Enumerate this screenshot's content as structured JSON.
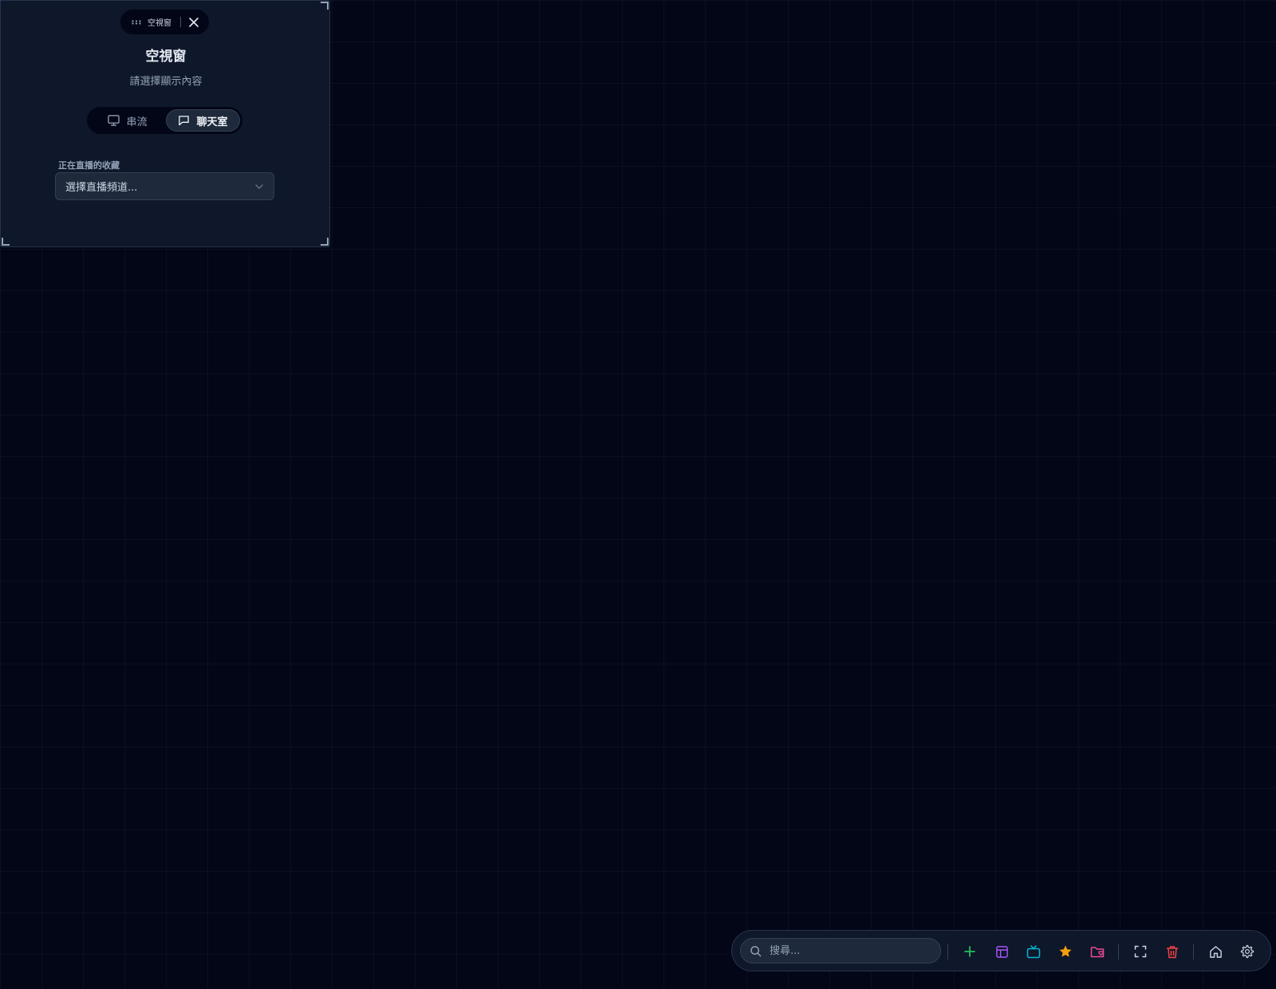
{
  "panel": {
    "header_label": "空視窗",
    "title": "空視窗",
    "subtitle": "請選擇顯示內容",
    "tabs": [
      {
        "label": "串流",
        "icon": "monitor-icon",
        "active": false
      },
      {
        "label": "聊天室",
        "icon": "message-square-icon",
        "active": true
      }
    ],
    "field_label": "正在直播的收藏",
    "select_placeholder": "選擇直播頻道..."
  },
  "toolbar": {
    "search_placeholder": "搜尋...",
    "buttons": [
      {
        "icon": "plus-icon",
        "color": "#22c55e"
      },
      {
        "icon": "layout-icon",
        "color": "#a855f7"
      },
      {
        "icon": "tv-icon",
        "color": "#06b6d4"
      },
      {
        "icon": "star-icon",
        "color": "#f59e0b"
      },
      {
        "icon": "folder-heart-icon",
        "color": "#ec4899"
      },
      {
        "icon": "fullscreen-icon",
        "color": "#cbd5e1"
      },
      {
        "icon": "trash-icon",
        "color": "#ef4444"
      },
      {
        "icon": "home-icon",
        "color": "#cbd5e1"
      },
      {
        "icon": "settings-icon",
        "color": "#cbd5e1"
      }
    ]
  }
}
